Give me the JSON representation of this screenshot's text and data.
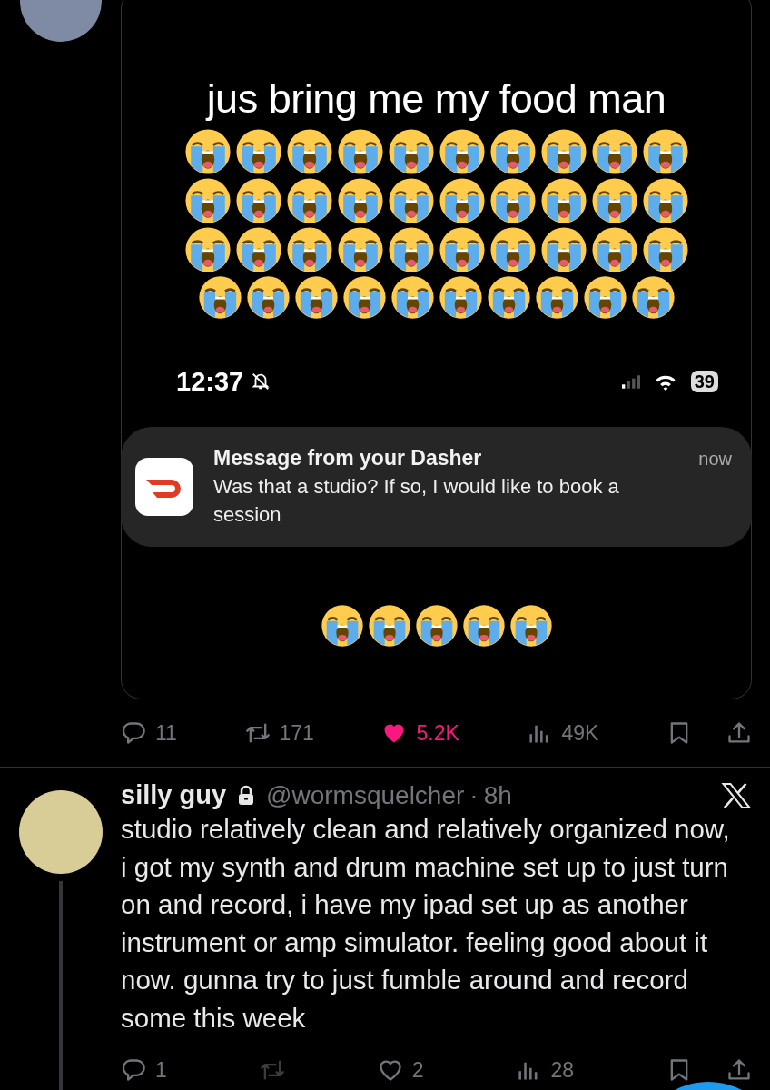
{
  "tweets": [
    {
      "kind": "media",
      "media": {
        "caption": "jus bring me my food man",
        "status_time": "12:37",
        "battery": "39",
        "notification": {
          "title": "Message from your Dasher",
          "time": "now",
          "body": "Was that a studio? If so, I would like to book a session"
        }
      },
      "actions": {
        "replies": "11",
        "reposts": "171",
        "likes": "5.2K",
        "views": "49K",
        "liked": true,
        "repost_disabled": false
      }
    },
    {
      "kind": "text",
      "author": {
        "name": "silly guy",
        "protected": true,
        "handle": "@wormsquelcher",
        "separator": "·",
        "time": "8h"
      },
      "text": "studio relatively clean and relatively organized now, i got my synth and drum machine set up to just turn on and record, i have my ipad set up as another instrument or amp simulator. feeling good about it now. gunna try to just fumble around and record some this week",
      "actions": {
        "replies": "1",
        "likes": "2",
        "views": "28",
        "liked": false,
        "repost_disabled": true
      }
    }
  ]
}
